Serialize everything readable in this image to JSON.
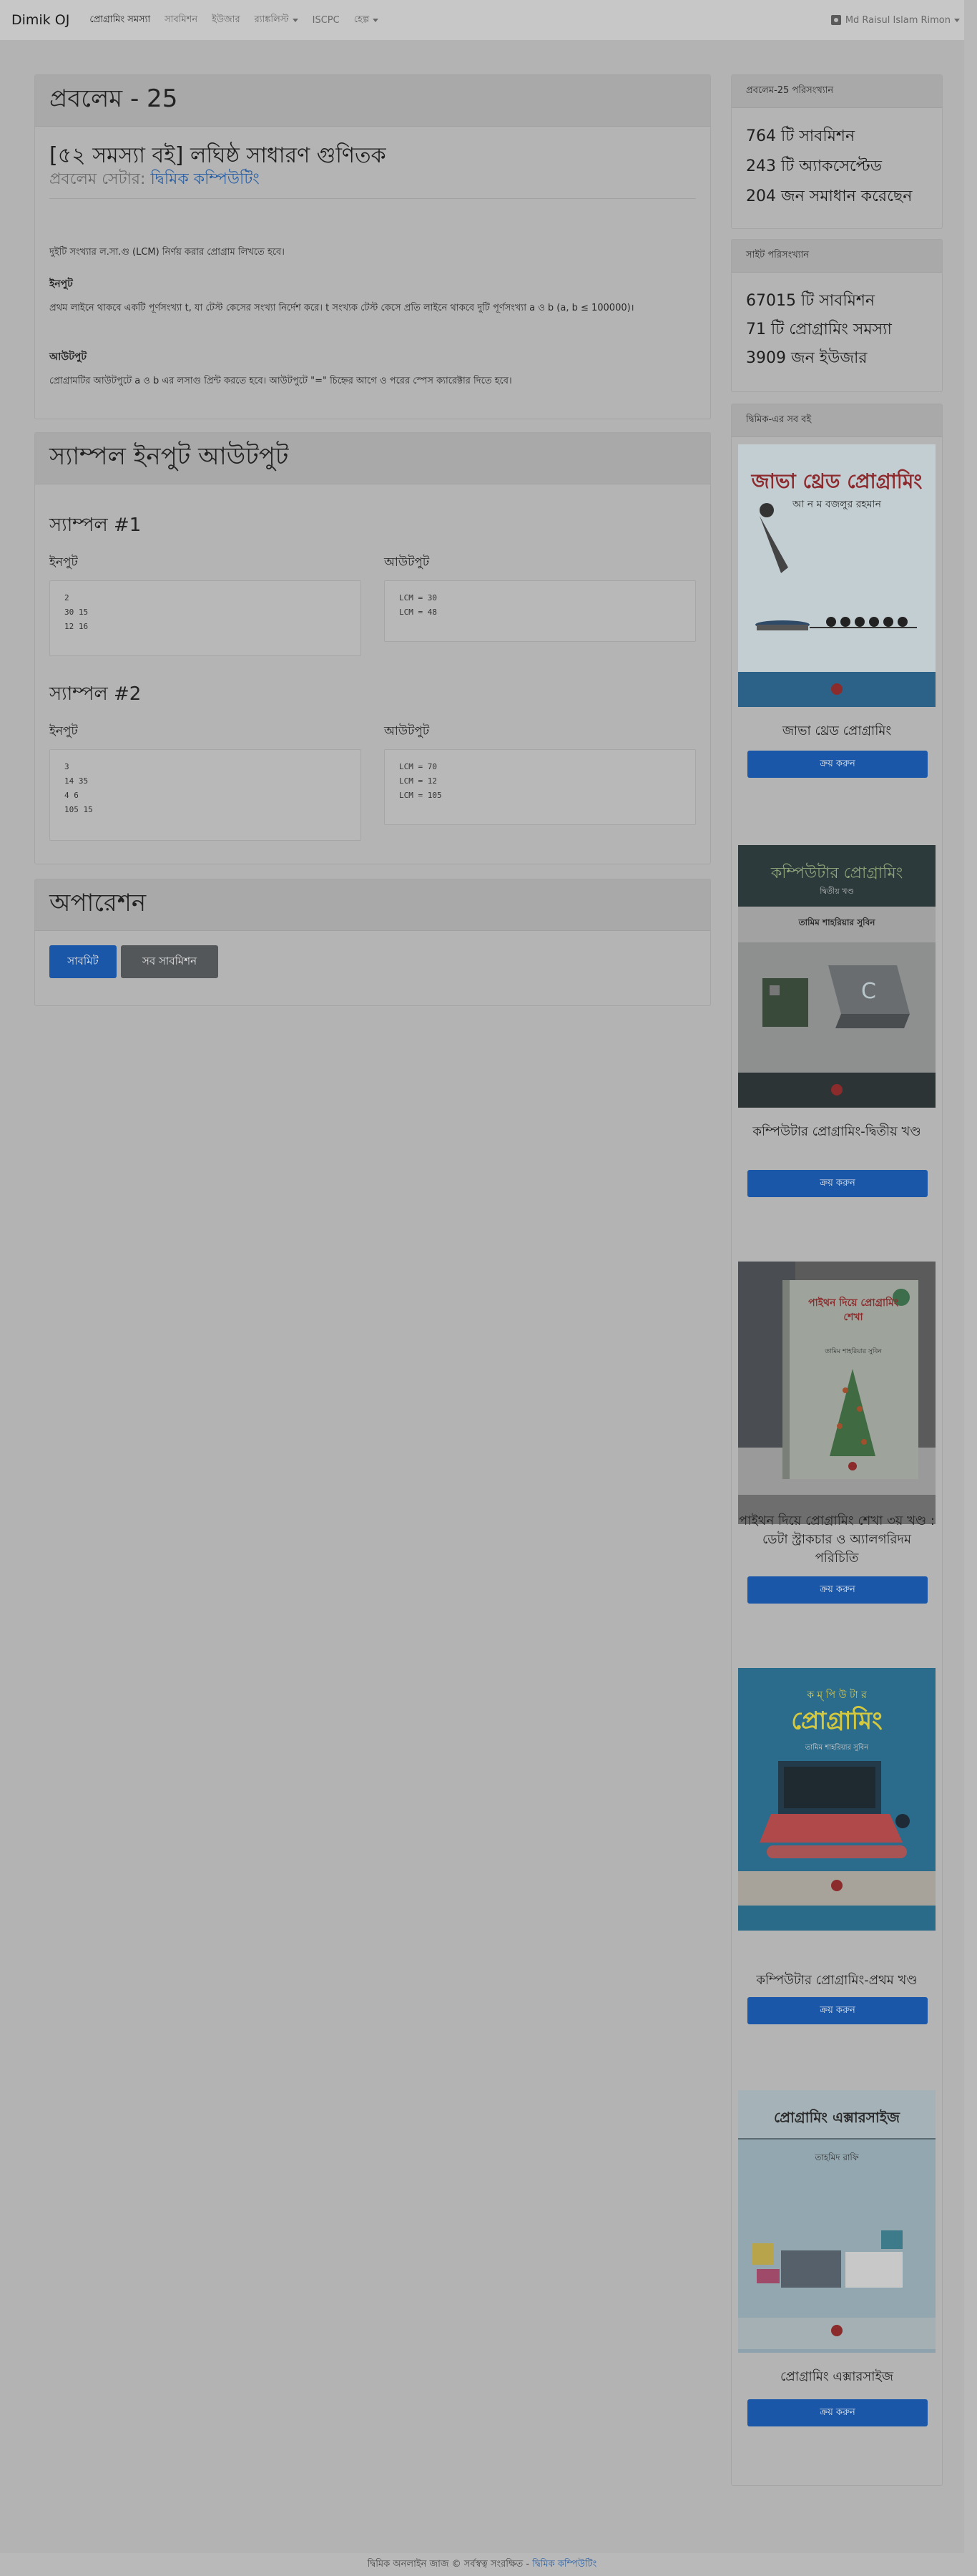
{
  "navbar": {
    "brand": "Dimik OJ",
    "items": [
      {
        "label": "প্রোগ্রামিং সমস্যা"
      },
      {
        "label": "সাবমিশন"
      },
      {
        "label": "ইউজার"
      },
      {
        "label": "র‍্যাঙ্কলিস্ট"
      },
      {
        "label": "ISCPC"
      },
      {
        "label": "হেল্প"
      }
    ],
    "user": "Md Raisul Islam Rimon"
  },
  "problem": {
    "header": "প্রবলেম - 25",
    "title": "[৫২ সমস্যা বই] লঘিষ্ঠ সাধারণ গুণিতক",
    "setter_prefix": "প্রবলেম সেটার:",
    "setter_name": "দ্বিমিক কম্পিউটিং",
    "statement": "দুইটি সংখ্যার ল.সা.গু (LCM) নির্ণয় করার প্রোগ্রাম লিখতে হবে।",
    "input_heading": "ইনপুট",
    "input_text": "প্রথম লাইনে থাকবে একটি পূর্ণসংখ্যা t, যা টেস্ট কেসের সংখ্যা নির্দেশ করে। t সংখ্যক টেস্ট কেসে প্রতি লাইনে থাকবে দুটি পূর্ণসংখ্যা a ও b (a, b ≤ 100000)।",
    "output_heading": "আউটপুট",
    "output_text": "প্রোগ্রামটির আউটপুটে a ও b এর লসাগু প্রিন্ট করতে হবে। আউটপুটে \"=\" চিহ্নের আগে ও পরের স্পেস ক্যারেক্টার দিতে হবে।"
  },
  "samples": {
    "header": "স্যাম্পল ইনপুট আউটপুট",
    "input_label": "ইনপুট",
    "output_label": "আউটপুট",
    "items": [
      {
        "title": "স্যাম্পল #1",
        "input": [
          "2",
          "30 15",
          "12 16"
        ],
        "output": [
          "LCM = 30",
          "LCM = 48"
        ]
      },
      {
        "title": "স্যাম্পল #2",
        "input": [
          "3",
          "14 35",
          "4 6",
          "105 15"
        ],
        "output": [
          "LCM = 70",
          "LCM = 12",
          "LCM = 105"
        ]
      }
    ]
  },
  "operations": {
    "header": "অপারেশন",
    "submit": "সাবমিট",
    "all_submissions": "সব সাবমিশন"
  },
  "problem_stats": {
    "header": "প্রবলেম-25 পরিসংখ্যান",
    "submissions": "764 টি সাবমিশন",
    "accepted": "243 টি অ্যাকসেপ্টেড",
    "solved_by": "204 জন সমাধান করেছেন"
  },
  "site_stats": {
    "header": "সাইট পরিসংখ্যান",
    "submissions": "67015 টি সাবমিশন",
    "problems": "71 টি প্রোগ্রামিং সমস্যা",
    "users": "3909 জন ইউজার"
  },
  "books": {
    "header": "দ্বিমিক-এর সব বই",
    "buy_label": "ক্রয় করুন",
    "items": [
      {
        "title": "জাভা থ্রেড প্রোগ্রামিং",
        "cover_title": "জাভা থ্রেড প্রোগ্রামিং",
        "cover_author": "আ ন ম বজলুর রহমান"
      },
      {
        "title": "কম্পিউটার প্রোগ্রামিং-দ্বিতীয় খণ্ড",
        "cover_title": "কম্পিউটার প্রোগ্রামিং",
        "cover_sub": "দ্বিতীয় খণ্ড",
        "cover_author": "তামিম শাহরিয়ার সুবিন"
      },
      {
        "title": "পাইথন দিয়ে প্রোগ্রামিং শেখা ৩য় খণ্ড : ডেটা স্ট্রাকচার ও অ্যালগরিদম পরিচিতি",
        "cover_title": "পাইথন দিয়ে প্রোগ্রামিং শেখা",
        "cover_author": "তামিম শাহরিয়ার সুবিন"
      },
      {
        "title": "কম্পিউটার প্রোগ্রামিং-প্রথম খণ্ড",
        "cover_title": "প্রোগ্রামিং",
        "cover_kicker": "ক ম্ পি উ টা র",
        "cover_author": "তামিম শাহরিয়ার সুবিন"
      },
      {
        "title": "প্রোগ্রামিং এক্সারসাইজ",
        "cover_title": "প্রোগ্রামিং এক্সারসাইজ",
        "cover_author": "তাহমিদ রাফি"
      }
    ]
  },
  "footer": {
    "text": "দ্বিমিক অনলাইন জাজ © সর্বস্বত্ব সংরক্ষিত -",
    "link": "দ্বিমিক কম্পিউটিং"
  }
}
